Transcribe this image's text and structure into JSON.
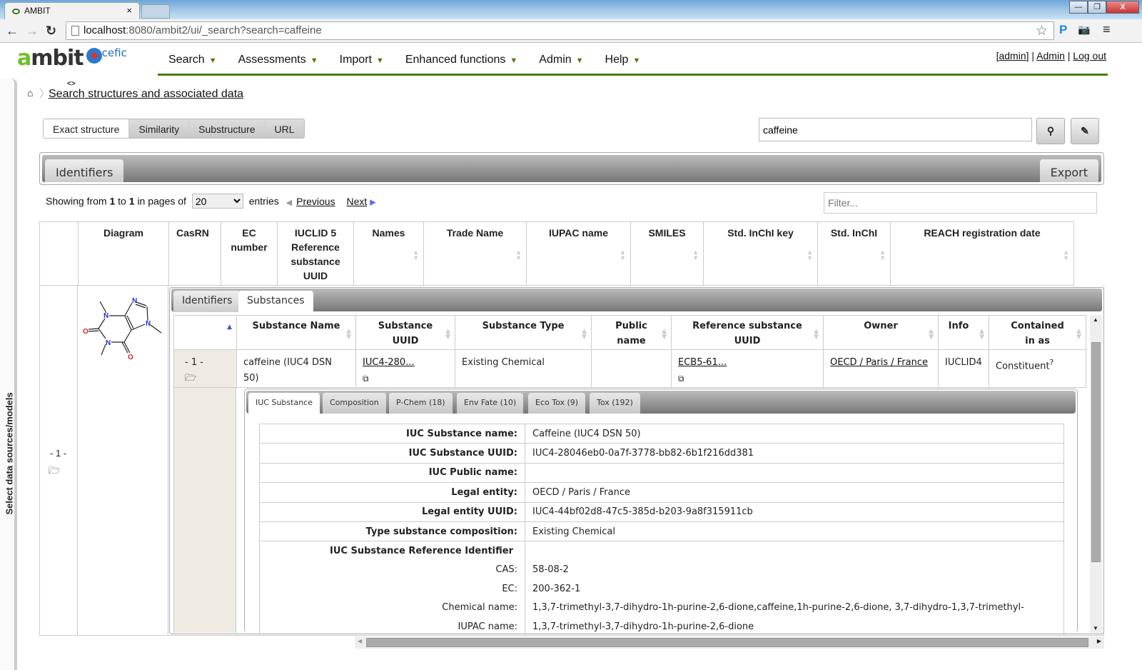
{
  "browser": {
    "tab_title": "AMBIT",
    "tab_close": "×",
    "url_host": "localhost",
    "url_rest": ":8080/ambit2/ui/_search?search=caffeine",
    "window_buttons": [
      "—",
      "❐",
      "X"
    ],
    "extensions": [
      "P",
      "📷",
      "≡"
    ]
  },
  "header": {
    "logo": {
      "a": "a",
      "mbit": "mbit",
      "cefic": "cefic"
    },
    "nav": [
      {
        "label": "Search"
      },
      {
        "label": "Assessments"
      },
      {
        "label": "Import"
      },
      {
        "label": "Enhanced functions"
      },
      {
        "label": "Admin"
      },
      {
        "label": "Help"
      }
    ],
    "caret": "▼",
    "user": {
      "bracket_open": "[",
      "username": "admin",
      "bracket_close": "]",
      "sep": " | ",
      "admin_link": "Admin",
      "logout_link": "Log out"
    }
  },
  "drawer": {
    "label": "Select data sources/models"
  },
  "breadcrumb": {
    "home_icon": "⌂",
    "sep": "〉",
    "toggle": "<>",
    "link": "Search structures and associated data"
  },
  "search": {
    "tabs": [
      {
        "label": "Exact structure",
        "active": true
      },
      {
        "label": "Similarity"
      },
      {
        "label": "Substructure"
      },
      {
        "label": "URL"
      }
    ],
    "query": "caffeine",
    "search_icon": "⚲",
    "draw_icon": "✎"
  },
  "identifiers_bar": {
    "tab": "Identifiers",
    "export": "Export"
  },
  "paging": {
    "showing": "Showing from",
    "from": "1",
    "to_word": "to",
    "to": "1",
    "pages_of": "in pages of",
    "page_size": "20",
    "entries": "entries",
    "previous": "Previous",
    "next": "Next",
    "filter_placeholder": "Filter..."
  },
  "main_table": {
    "columns": [
      "",
      "Diagram",
      "CasRN",
      "EC number",
      "IUCLID 5 Reference substance UUID",
      "Names",
      "Trade Name",
      "IUPAC name",
      "SMILES",
      "Std. InChI key",
      "Std. InChI",
      "REACH registration date"
    ],
    "row": {
      "index": "- 1 -",
      "folder_icon": "🗁"
    }
  },
  "structure": {
    "atoms": {
      "N": "N",
      "O": "O"
    },
    "name": "caffeine"
  },
  "substances": {
    "tabs": [
      {
        "label": "Identifiers"
      },
      {
        "label": "Substances",
        "active": true
      }
    ],
    "columns": [
      "",
      "Substance Name",
      "Substance UUID",
      "Substance Type",
      "Public name",
      "Reference substance UUID",
      "Owner",
      "Info",
      "Contained in as"
    ],
    "rows": [
      {
        "index": "- 1 -",
        "name": "caffeine (IUC4 DSN 50)",
        "uuid": "IUC4-280...",
        "type": "Existing Chemical",
        "public_name": "",
        "ref_uuid": "ECB5-61...",
        "owner": "OECD / Paris / France",
        "info": "IUCLID4",
        "contained": "Constituent",
        "contained_sup": "?"
      }
    ]
  },
  "detail": {
    "tabs": [
      {
        "label": "IUC Substance",
        "active": true
      },
      {
        "label": "Composition"
      },
      {
        "label": "P-Chem (18)"
      },
      {
        "label": "Env Fate (10)"
      },
      {
        "label": "Eco Tox (9)"
      },
      {
        "label": "Tox (192)"
      }
    ],
    "fields": [
      {
        "k": "IUC Substance name:",
        "v": "Caffeine (IUC4 DSN 50)"
      },
      {
        "k": "IUC Substance UUID:",
        "v": "IUC4-28046eb0-0a7f-3778-bb82-6b1f216dd381"
      },
      {
        "k": "IUC Public name:",
        "v": ""
      },
      {
        "k": "Legal entity:",
        "v": "OECD / Paris / France"
      },
      {
        "k": "Legal entity UUID:",
        "v": "IUC4-44bf02d8-47c5-385d-b203-9a8f315911cb"
      },
      {
        "k": "Type substance composition:",
        "v": "Existing Chemical"
      }
    ],
    "ref_identifier_heading": "IUC Substance Reference Identifier",
    "ref_fields": [
      {
        "k": "CAS:",
        "v": "58-08-2"
      },
      {
        "k": "EC:",
        "v": "200-362-1"
      },
      {
        "k": "Chemical name:",
        "v": "1,3,7-trimethyl-3,7-dihydro-1h-purine-2,6-dione,caffeine,1h-purine-2,6-dione, 3,7-dihydro-1,3,7-trimethyl-"
      },
      {
        "k": "IUPAC name:",
        "v": "1,3,7-trimethyl-3,7-dihydro-1h-purine-2,6-dione"
      }
    ]
  },
  "colors": {
    "accent_green": "#4f7a0c",
    "logo_green": "#6fbf28",
    "index_bg": "#efebe2",
    "bar_gray": "#777777"
  }
}
